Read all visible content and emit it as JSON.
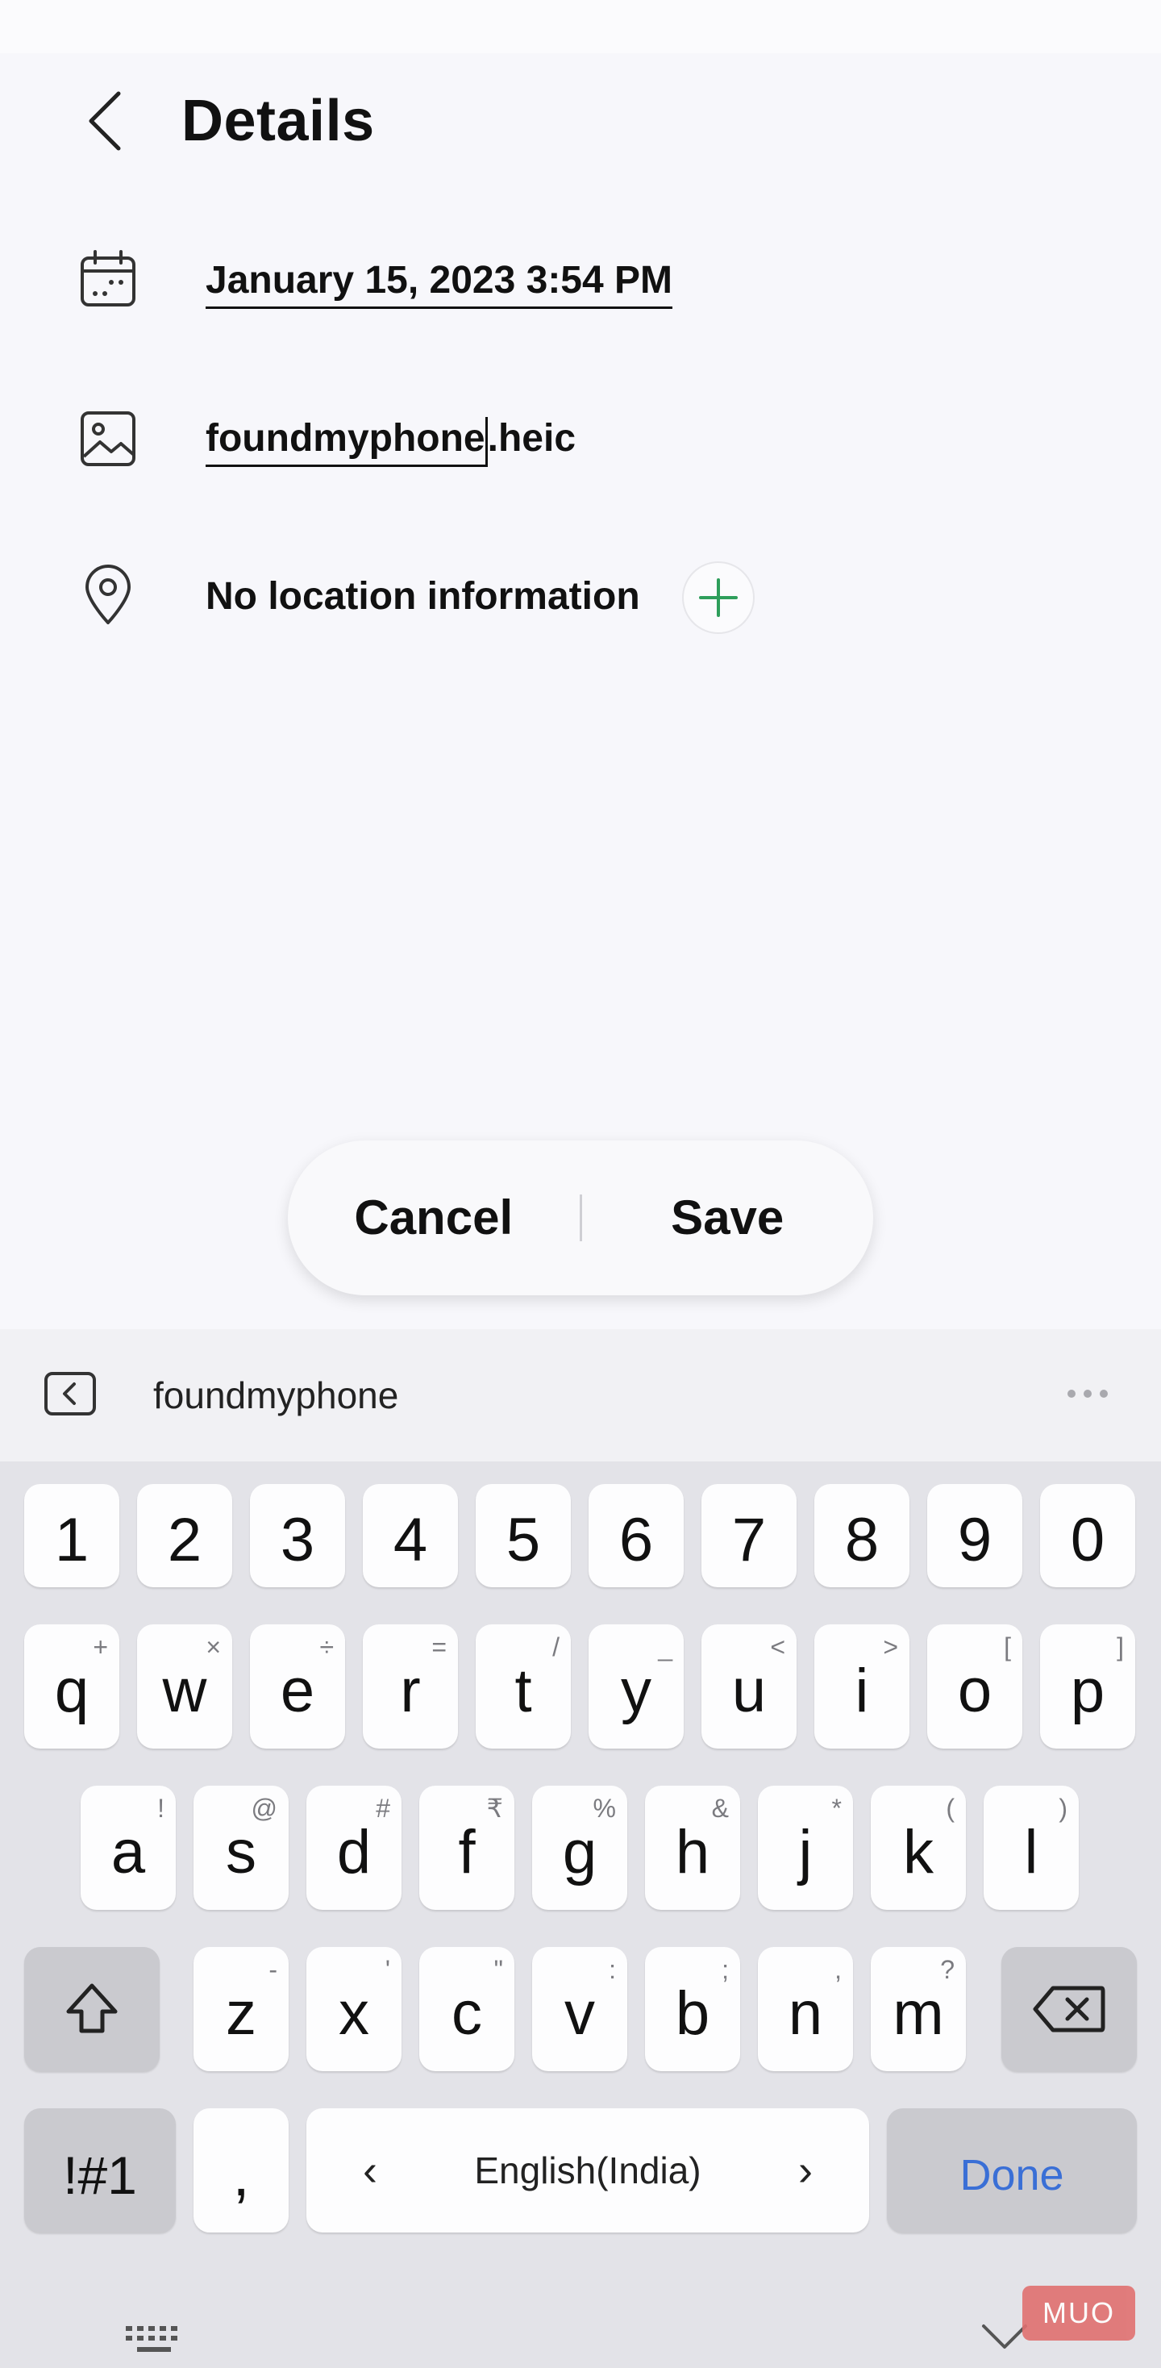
{
  "header": {
    "title": "Details"
  },
  "details": {
    "date": "January 15, 2023 3:54 PM",
    "filename_stem": "foundmyphone",
    "filename_ext": ".heic",
    "location": "No location information"
  },
  "actions": {
    "cancel": "Cancel",
    "save": "Save"
  },
  "keyboard": {
    "suggestion": "foundmyphone",
    "number_row": [
      "1",
      "2",
      "3",
      "4",
      "5",
      "6",
      "7",
      "8",
      "9",
      "0"
    ],
    "row1": [
      {
        "key": "q",
        "sub": "+"
      },
      {
        "key": "w",
        "sub": "×"
      },
      {
        "key": "e",
        "sub": "÷"
      },
      {
        "key": "r",
        "sub": "="
      },
      {
        "key": "t",
        "sub": "/"
      },
      {
        "key": "y",
        "sub": "_"
      },
      {
        "key": "u",
        "sub": "<"
      },
      {
        "key": "i",
        "sub": ">"
      },
      {
        "key": "o",
        "sub": "["
      },
      {
        "key": "p",
        "sub": "]"
      }
    ],
    "row2": [
      {
        "key": "a",
        "sub": "!"
      },
      {
        "key": "s",
        "sub": "@"
      },
      {
        "key": "d",
        "sub": "#"
      },
      {
        "key": "f",
        "sub": "₹"
      },
      {
        "key": "g",
        "sub": "%"
      },
      {
        "key": "h",
        "sub": "&"
      },
      {
        "key": "j",
        "sub": "*"
      },
      {
        "key": "k",
        "sub": "("
      },
      {
        "key": "l",
        "sub": ")"
      }
    ],
    "row3": [
      {
        "key": "z",
        "sub": "-"
      },
      {
        "key": "x",
        "sub": "'"
      },
      {
        "key": "c",
        "sub": "\""
      },
      {
        "key": "v",
        "sub": ":"
      },
      {
        "key": "b",
        "sub": ";"
      },
      {
        "key": "n",
        "sub": ","
      },
      {
        "key": "m",
        "sub": "?"
      }
    ],
    "symbols_label": "!#1",
    "comma_label": ",",
    "language": "English(India)",
    "done_label": "Done"
  },
  "watermark": "MUO",
  "colors": {
    "accent_green": "#2e9e5b",
    "done_blue": "#3a6fd6"
  },
  "icons": {
    "back": "chevron-left-icon",
    "date": "calendar-icon",
    "file": "image-icon",
    "location": "location-pin-icon",
    "add": "plus-icon",
    "shift": "shift-icon",
    "backspace": "backspace-icon"
  }
}
